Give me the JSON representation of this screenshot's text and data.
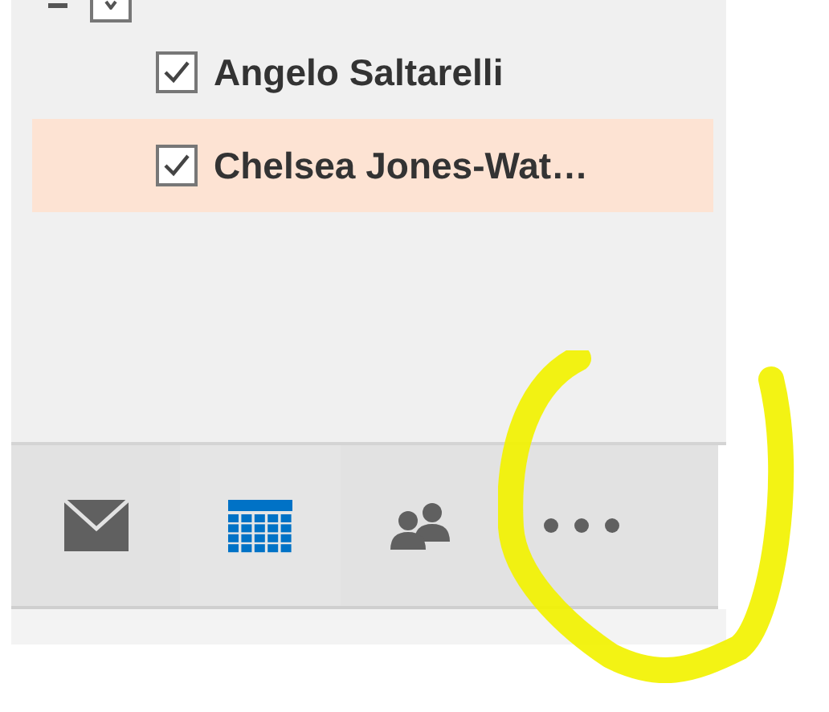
{
  "calendars": [
    {
      "label": "Angelo Saltarelli",
      "checked": true,
      "selected": false
    },
    {
      "label": "Chelsea Jones-Wat…",
      "checked": true,
      "selected": true
    }
  ],
  "group": {
    "checked": true
  },
  "nav": [
    {
      "kind": "mail",
      "selected": false
    },
    {
      "kind": "calendar",
      "selected": true
    },
    {
      "kind": "people",
      "selected": false
    },
    {
      "kind": "more",
      "selected": false
    }
  ]
}
